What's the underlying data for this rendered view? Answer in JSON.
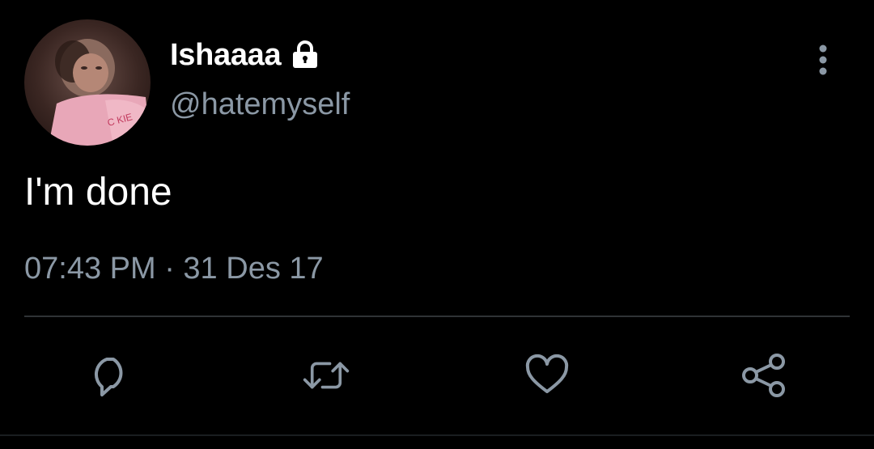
{
  "user": {
    "display_name": "Ishaaaa",
    "handle": "@hatemyself",
    "protected": true,
    "avatar_icon": "avatar-photo",
    "lock_icon": "lock-icon"
  },
  "tweet": {
    "text": "I'm done",
    "timestamp": "07:43 PM · 31 Des 17"
  },
  "actions": {
    "more_icon": "more-vertical-icon",
    "reply_icon": "reply-icon",
    "retweet_icon": "retweet-icon",
    "like_icon": "like-icon",
    "share_icon": "share-icon"
  },
  "colors": {
    "background": "#000000",
    "primary_text": "#ffffff",
    "secondary_text": "#8b98a5",
    "divider": "#2f3336"
  }
}
